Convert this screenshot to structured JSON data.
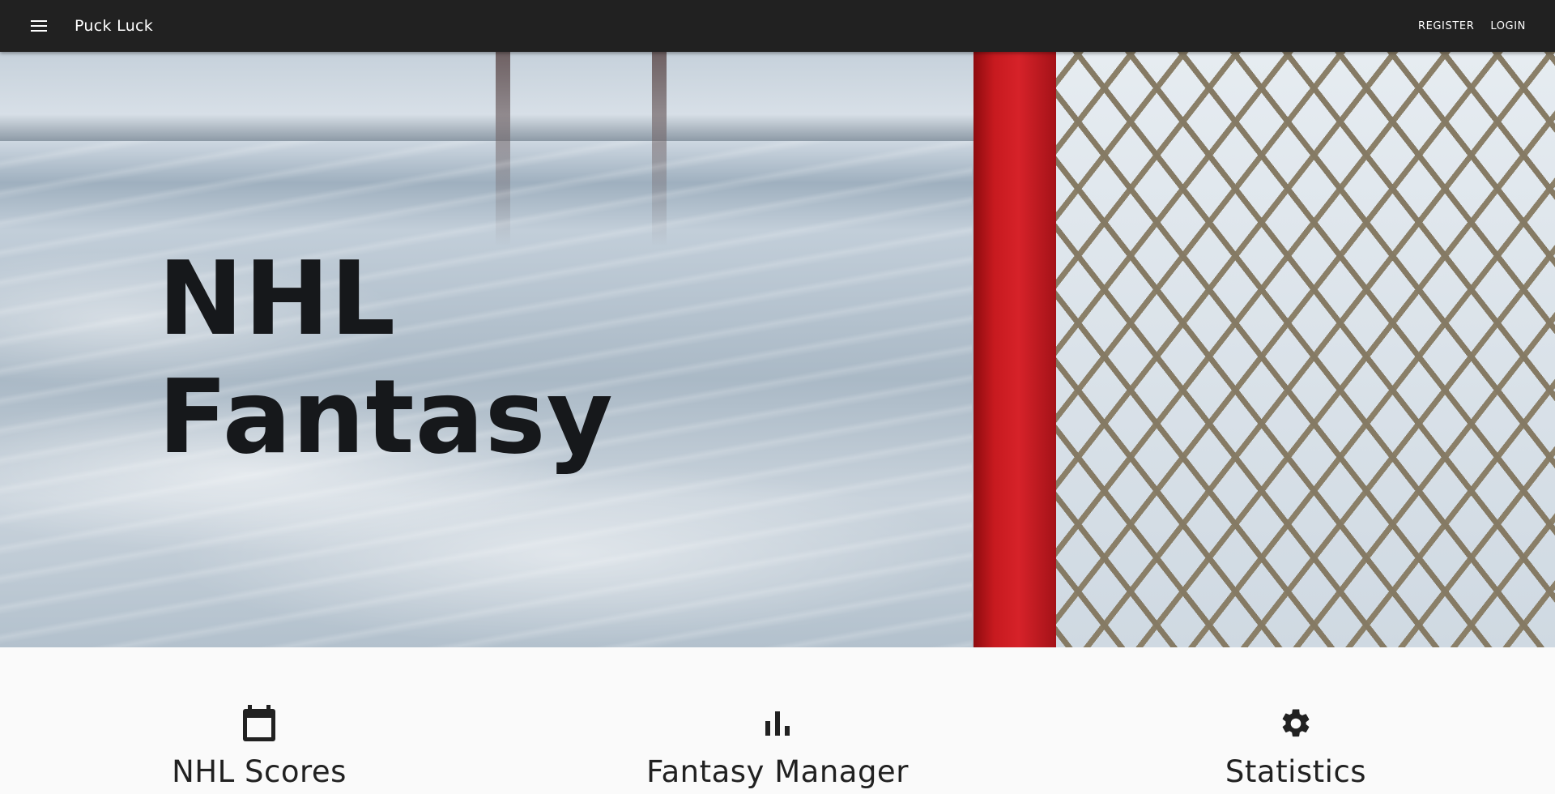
{
  "appbar": {
    "title": "Puck Luck",
    "register_label": "REGISTER",
    "login_label": "LOGIN",
    "background_color": "#212121"
  },
  "hero": {
    "title_line1": "NHL",
    "title_line2": "Fantasy"
  },
  "features": [
    {
      "label": "NHL Scores",
      "icon": "calendar-icon"
    },
    {
      "label": "Fantasy Manager",
      "icon": "bar-chart-icon"
    },
    {
      "label": "Statistics",
      "icon": "gear-icon"
    }
  ]
}
